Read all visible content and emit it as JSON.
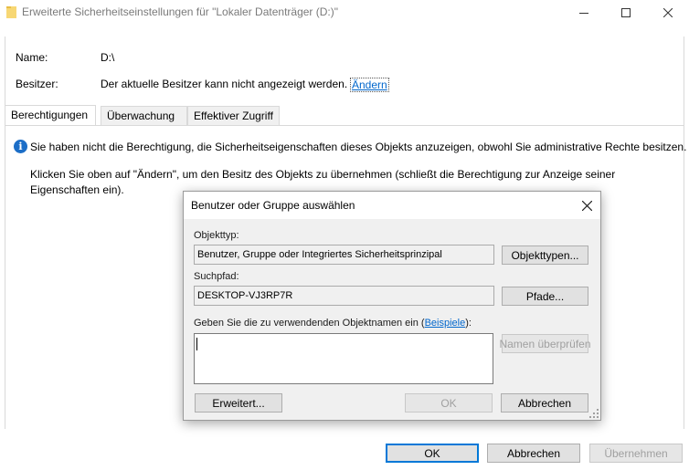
{
  "window": {
    "title": "Erweiterte Sicherheitseinstellungen für \"Lokaler Datenträger (D:)\""
  },
  "info": {
    "name_label": "Name:",
    "name_value": "D:\\",
    "owner_label": "Besitzer:",
    "owner_value": "Der aktuelle Besitzer kann nicht angezeigt werden.",
    "change_link": "Ändern"
  },
  "tabs": [
    {
      "label": "Berechtigungen",
      "active": true
    },
    {
      "label": "Überwachung",
      "active": false
    },
    {
      "label": "Effektiver Zugriff",
      "active": false
    }
  ],
  "message": {
    "line1": "Sie haben nicht die Berechtigung, die Sicherheitseigenschaften dieses Objekts anzuzeigen, obwohl Sie administrative Rechte besitzen.",
    "line2": "Klicken Sie oben auf \"Ändern\", um den Besitz des Objekts zu übernehmen (schließt die Berechtigung zur Anzeige seiner",
    "line3": "Eigenschaften ein)."
  },
  "bottom_buttons": {
    "ok": "OK",
    "cancel": "Abbrechen",
    "apply": "Übernehmen"
  },
  "dialog": {
    "title": "Benutzer oder Gruppe auswählen",
    "objecttype_label": "Objekttyp:",
    "objecttype_value": "Benutzer, Gruppe oder Integriertes Sicherheitsprinzipal",
    "objecttypes_button": "Objekttypen...",
    "path_label": "Suchpfad:",
    "path_value": "DESKTOP-VJ3RP7R",
    "paths_button": "Pfade...",
    "names_label_pre": "Geben Sie die zu verwendenden Objektnamen ein (",
    "examples_link": "Beispiele",
    "names_label_post": "):",
    "names_input_value": "",
    "check_names_button": "Namen überprüfen",
    "advanced_button": "Erweitert...",
    "ok_button": "OK",
    "cancel_button": "Abbrechen"
  },
  "colors": {
    "accent": "#0078d7",
    "link": "#0066cc",
    "info_icon": "#1c6ec7",
    "dialog_bg": "#f0f0f0"
  }
}
